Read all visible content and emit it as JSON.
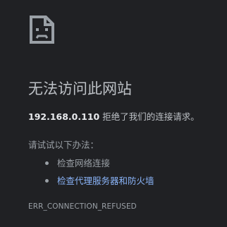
{
  "icon": "sad-page-icon",
  "heading": "无法访问此网站",
  "error": {
    "host": "192.168.0.110",
    "message": " 拒绝了我们的连接请求。"
  },
  "suggestions": {
    "label": "请试试以下办法：",
    "items": [
      {
        "text": "检查网络连接"
      },
      {
        "text": "检查代理服务器和防火墙"
      }
    ]
  },
  "error_code": "ERR_CONNECTION_REFUSED"
}
